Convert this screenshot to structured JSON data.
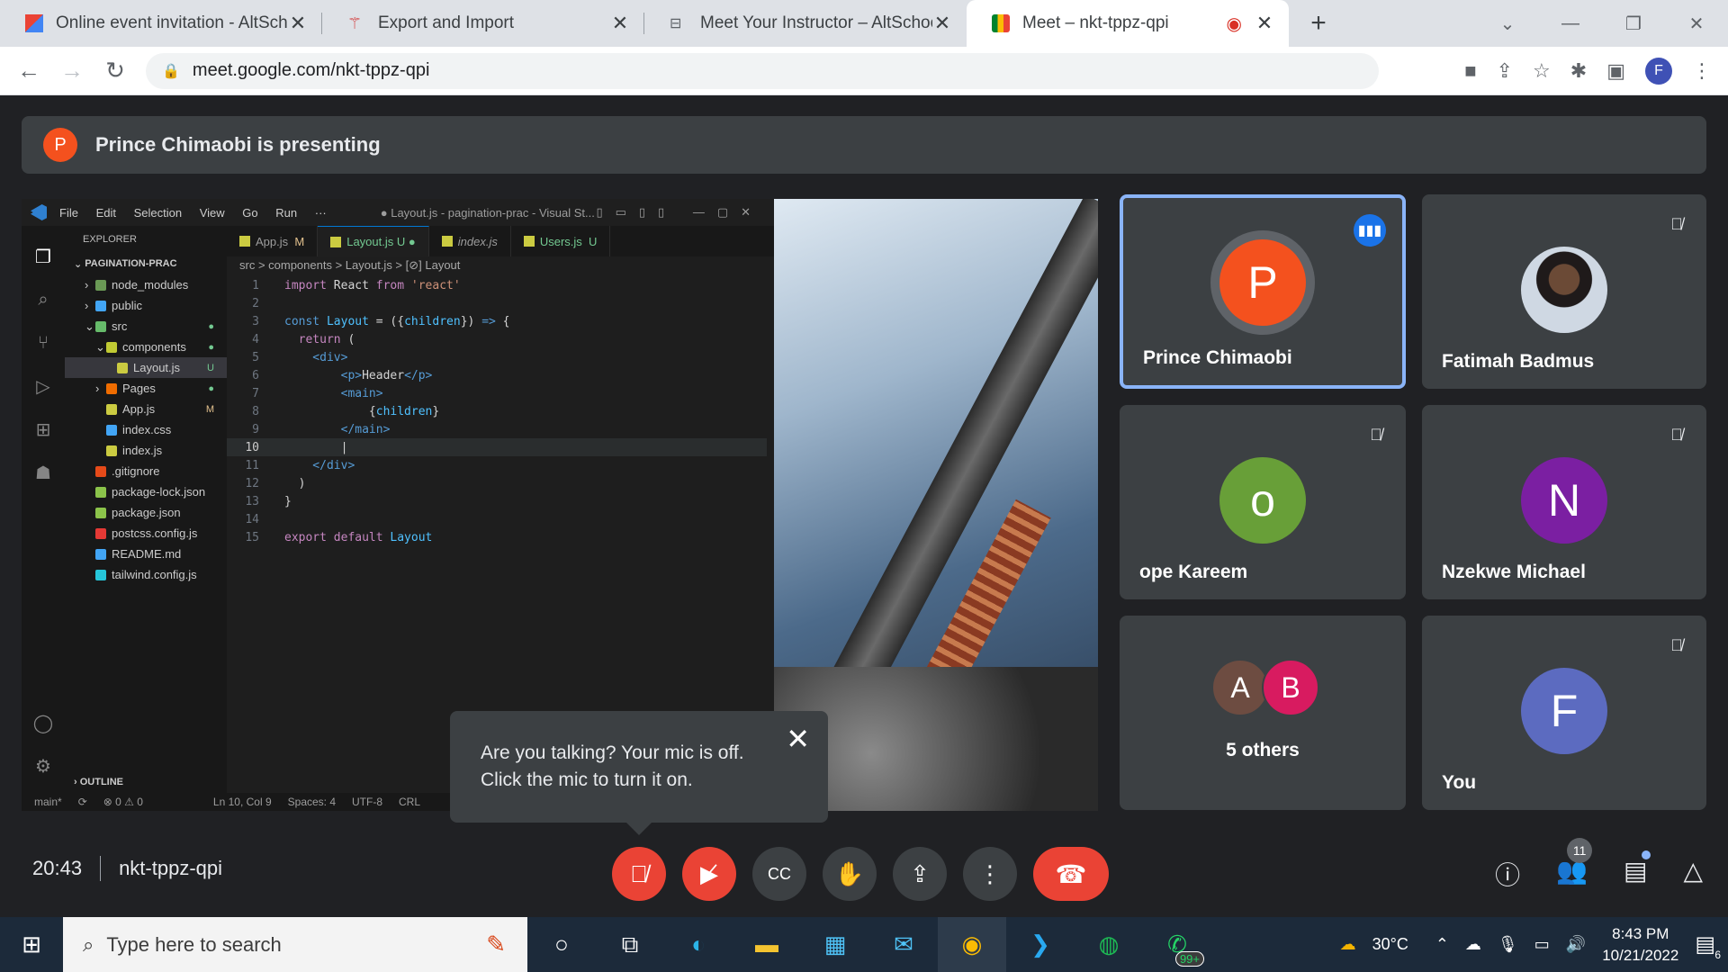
{
  "browser": {
    "tabs": [
      {
        "label": "Online event invitation - AltScho",
        "icon": "gmail-icon",
        "active": false
      },
      {
        "label": "Export and Import",
        "icon": "app-icon",
        "active": false
      },
      {
        "label": "Meet Your Instructor – AltSchool",
        "icon": "page-icon",
        "active": false
      },
      {
        "label": "Meet – nkt-tppz-qpi",
        "icon": "meet-icon",
        "active": true
      }
    ],
    "url": "meet.google.com/nkt-tppz-qpi",
    "profile_initial": "F"
  },
  "meet": {
    "presenter_initial": "P",
    "presenting_text": "Prince Chimaobi is presenting",
    "time": "20:43",
    "meeting_code": "nkt-tppz-qpi",
    "participants": [
      {
        "name": "Prince Chimaobi",
        "initial": "P",
        "avatar_color": "#f4511e",
        "speaking": true,
        "muted": false
      },
      {
        "name": "Fatimah Badmus",
        "initial": "",
        "photo": true,
        "muted": true
      },
      {
        "name": "ope Kareem",
        "initial": "o",
        "avatar_color": "#689f38",
        "muted": true
      },
      {
        "name": "Nzekwe Michael",
        "initial": "N",
        "avatar_color": "#7b1fa2",
        "muted": true
      },
      {
        "name": "You",
        "initial": "F",
        "avatar_color": "#5c6bc0",
        "muted": true
      }
    ],
    "others": {
      "label": "5 others",
      "initials": [
        "A",
        "B"
      ],
      "colors": [
        "#6d4c41",
        "#d81b60"
      ]
    },
    "mic_tooltip": {
      "line1": "Are you talking? Your mic is off.",
      "line2": "Click the mic to turn it on."
    },
    "people_count": "11"
  },
  "vscode": {
    "menu": [
      "File",
      "Edit",
      "Selection",
      "View",
      "Go",
      "Run",
      "···"
    ],
    "title": "● Layout.js - pagination-prac - Visual St...",
    "explorer_label": "EXPLORER",
    "root": "PAGINATION-PRAC",
    "tree": [
      {
        "name": "node_modules",
        "indent": 1,
        "color": "#6a9955",
        "badge": ""
      },
      {
        "name": "public",
        "indent": 1,
        "color": "#42a5f5",
        "badge": ""
      },
      {
        "name": "src",
        "indent": 1,
        "color": "#66bb6a",
        "badge": "●"
      },
      {
        "name": "components",
        "indent": 2,
        "color": "#c0ca33",
        "badge": "●"
      },
      {
        "name": "Layout.js",
        "indent": 3,
        "color": "#cbcb41",
        "badge": "U"
      },
      {
        "name": "Pages",
        "indent": 2,
        "color": "#ef6c00",
        "badge": "●"
      },
      {
        "name": "App.js",
        "indent": 2,
        "color": "#cbcb41",
        "badge": "M"
      },
      {
        "name": "index.css",
        "indent": 2,
        "color": "#42a5f5",
        "badge": ""
      },
      {
        "name": "index.js",
        "indent": 2,
        "color": "#cbcb41",
        "badge": ""
      },
      {
        "name": ".gitignore",
        "indent": 1,
        "color": "#e64a19",
        "badge": ""
      },
      {
        "name": "package-lock.json",
        "indent": 1,
        "color": "#8bc34a",
        "badge": ""
      },
      {
        "name": "package.json",
        "indent": 1,
        "color": "#8bc34a",
        "badge": ""
      },
      {
        "name": "postcss.config.js",
        "indent": 1,
        "color": "#e53935",
        "badge": ""
      },
      {
        "name": "README.md",
        "indent": 1,
        "color": "#42a5f5",
        "badge": ""
      },
      {
        "name": "tailwind.config.js",
        "indent": 1,
        "color": "#26c6da",
        "badge": ""
      }
    ],
    "outline_label": "OUTLINE",
    "tabs": [
      {
        "name": "App.js",
        "badge": "M",
        "active": false
      },
      {
        "name": "Layout.js",
        "badge": "U ●",
        "active": true
      },
      {
        "name": "index.js",
        "badge": "",
        "active": false
      },
      {
        "name": "Users.js",
        "badge": "U",
        "active": false
      }
    ],
    "breadcrumb": "src > components > Layout.js > [⊘] Layout",
    "status_branch": "main*",
    "status_errors": "⊗ 0 ⚠ 0",
    "status_pos": "Ln 10, Col 9",
    "status_spaces": "Spaces: 4",
    "status_enc": "UTF-8",
    "status_eol": "CRL"
  },
  "taskbar": {
    "search_placeholder": "Type here to search",
    "temperature": "30°C",
    "time": "8:43 PM",
    "date": "10/21/2022",
    "whatsapp_badge": "99+",
    "notification_count": "6"
  }
}
